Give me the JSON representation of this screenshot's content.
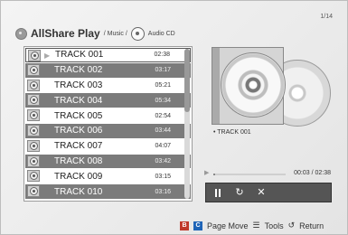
{
  "header": {
    "app_title": "AllShare Play",
    "crumb_music": "/ Music /",
    "crumb_audio": "Audio CD",
    "page_count": "1/14"
  },
  "tracks": [
    {
      "title": "TRACK 001",
      "duration": "02:38"
    },
    {
      "title": "TRACK 002",
      "duration": "03:17"
    },
    {
      "title": "TRACK 003",
      "duration": "05:21"
    },
    {
      "title": "TRACK 004",
      "duration": "05:34"
    },
    {
      "title": "TRACK 005",
      "duration": "02:54"
    },
    {
      "title": "TRACK 006",
      "duration": "03:44"
    },
    {
      "title": "TRACK 007",
      "duration": "04:07"
    },
    {
      "title": "TRACK 008",
      "duration": "03:42"
    },
    {
      "title": "TRACK 009",
      "duration": "03:15"
    },
    {
      "title": "TRACK 010",
      "duration": "03:16"
    }
  ],
  "now_playing": {
    "title": "TRACK 001",
    "time": "00:03 / 02:38",
    "progress_fraction": 0.02
  },
  "footer": {
    "key_b": "B",
    "key_c": "C",
    "page_move": "Page Move",
    "tools": "Tools",
    "return": "Return"
  },
  "colors": {
    "even_row": "#7b7b7b",
    "key_b": "#c0392b",
    "key_c": "#1f64b7"
  }
}
